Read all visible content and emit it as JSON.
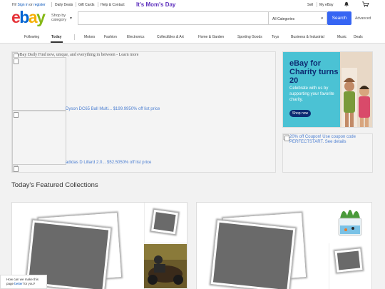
{
  "topbar": {
    "greeting_prefix": "Hi! ",
    "sign_in": "Sign in",
    "or": " or ",
    "register": "register",
    "daily_deals": "Daily Deals",
    "gift_cards": "Gift Cards",
    "help": "Help & Contact",
    "promo": "It's Mom's Day",
    "sell": "Sell",
    "my_ebay": "My eBay"
  },
  "header": {
    "logo": [
      "e",
      "b",
      "a",
      "y"
    ],
    "shop_by": "Shop by category",
    "search_placeholder": "",
    "category": "All Categories",
    "search_button": "Search",
    "advanced": "Advanced"
  },
  "nav": {
    "items": [
      "Following",
      "Today",
      "Motors",
      "Fashion",
      "Electronics",
      "Collectibles & Art",
      "Home & Garden",
      "Sporting Goods",
      "Toys",
      "Business & Industrial",
      "Music",
      "Deals"
    ],
    "active": "Today"
  },
  "hero": {
    "alt_text": "eBay Daily Find new, unique, and everything in between - Learn more",
    "deals": [
      "Dyson DC65 Ball Multi... $199.9950% off list price",
      "adidas D Lillard 2.0... $52.5050% off list price"
    ]
  },
  "charity": {
    "title": "eBay for Charity turns 20",
    "description": "Celebrate with us by supporting your favorite charity.",
    "button": "Shop now"
  },
  "coupon": {
    "alt_text": "20% off Coupon! Use coupon code PERFECTSTART. See details"
  },
  "featured": {
    "heading": "Today's Featured Collections"
  },
  "toast": {
    "line1": "How can we make this",
    "prefix": "page ",
    "better": "better",
    "suffix": " for you?"
  },
  "colors": {
    "search_button": "#3665f3",
    "promo": "#5d2fbd",
    "charity_bg": "#4bc2d4",
    "charity_title": "#0d2c72",
    "link": "#0654ba"
  }
}
